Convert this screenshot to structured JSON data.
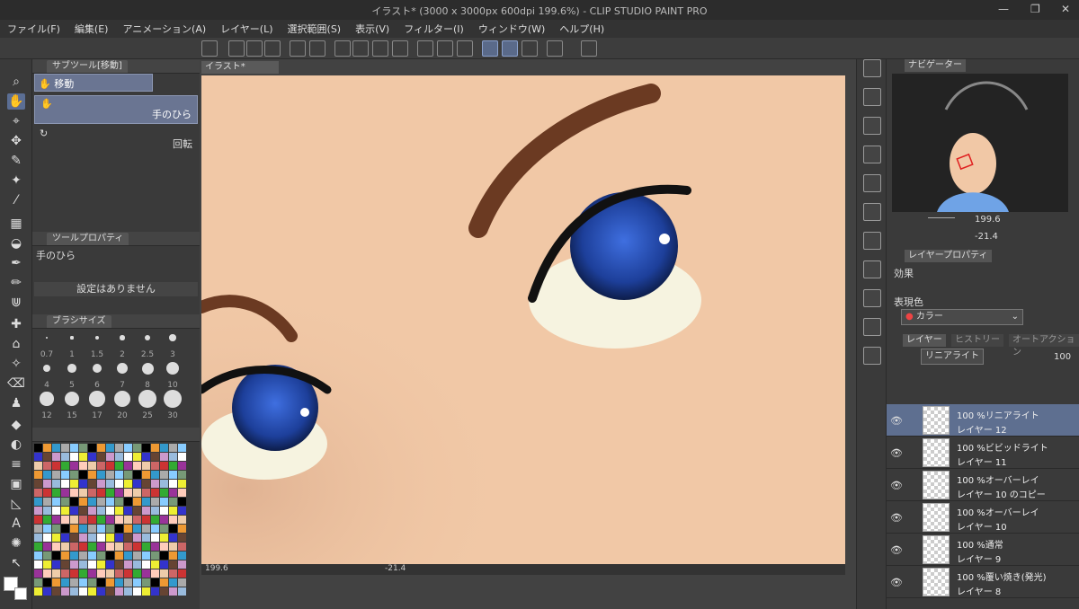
{
  "window": {
    "title": "イラスト* (3000 x 3000px 600dpi 199.6%) - CLIP STUDIO PAINT PRO",
    "minimize_glyph": "—",
    "maximize_glyph": "❐",
    "close_glyph": "✕"
  },
  "menu": [
    "ファイル(F)",
    "編集(E)",
    "アニメーション(A)",
    "レイヤー(L)",
    "選択範囲(S)",
    "表示(V)",
    "フィルター(I)",
    "ウィンドウ(W)",
    "ヘルプ(H)"
  ],
  "subtool_panel": {
    "tab": "サブツール[移動]",
    "group": "移動",
    "items": [
      {
        "label": "手のひら",
        "selected": true
      },
      {
        "label": "回転",
        "selected": false
      }
    ]
  },
  "tool_property": {
    "tab": "ツールプロパティ",
    "tool_name": "手のひら",
    "empty_msg": "設定はありません"
  },
  "brush_size": {
    "tab": "ブラシサイズ",
    "sizes": [
      "0.7",
      "1",
      "1.5",
      "2",
      "2.5",
      "3",
      "4",
      "5",
      "6",
      "7",
      "8",
      "10",
      "12",
      "15",
      "17",
      "20",
      "25",
      "30"
    ]
  },
  "canvas": {
    "tab": "イラスト*",
    "zoom": "199.6",
    "rotation": "-21.4"
  },
  "navigator": {
    "tab": "ナビゲーター",
    "zoom": "199.6",
    "rotation": "-21.4"
  },
  "layer_property": {
    "tab": "レイヤープロパティ",
    "effect_label": "効果",
    "expression_label": "表現色",
    "expression_value": "カラー"
  },
  "layers_panel": {
    "tabs": [
      "レイヤー",
      "ヒストリー",
      "オートアクション"
    ],
    "blend_mode": "リニアライト",
    "opacity": "100",
    "layers": [
      {
        "mode": "100 %リニアライト",
        "name": "レイヤー 12",
        "selected": true
      },
      {
        "mode": "100 %ビビッドライト",
        "name": "レイヤー 11",
        "selected": false
      },
      {
        "mode": "100 %オーバーレイ",
        "name": "レイヤー 10 のコピー",
        "selected": false
      },
      {
        "mode": "100 %オーバーレイ",
        "name": "レイヤー 10",
        "selected": false
      },
      {
        "mode": "100 %通常",
        "name": "レイヤー 9",
        "selected": false
      },
      {
        "mode": "100 %覆い焼き(発光)",
        "name": "レイヤー 8",
        "selected": false
      }
    ]
  },
  "colors": {
    "accent": "#5e6f90",
    "skin": "#f1c8a6",
    "iris": "#1d3f9a"
  }
}
